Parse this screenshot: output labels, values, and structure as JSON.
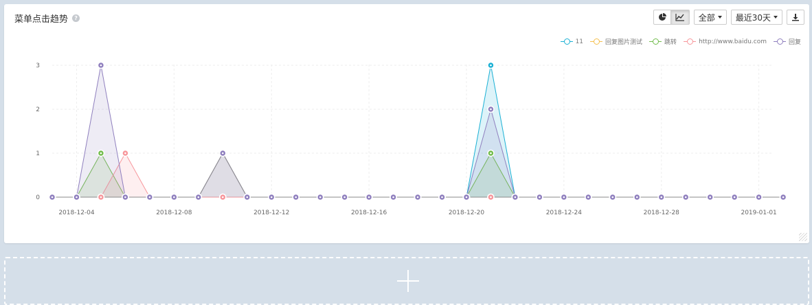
{
  "card": {
    "title": "菜单点击趋势",
    "help_icon": "question-circle-icon"
  },
  "toolbar": {
    "pie_icon": "pie-chart-icon",
    "line_icon": "line-chart-icon",
    "filter_label": "全部",
    "range_label": "最近30天",
    "download_icon": "download-icon"
  },
  "add_panel": {
    "icon": "plus-icon"
  },
  "chart_data": {
    "type": "area",
    "x": [
      "2018-12-03",
      "2018-12-04",
      "2018-12-05",
      "2018-12-06",
      "2018-12-07",
      "2018-12-08",
      "2018-12-09",
      "2018-12-10",
      "2018-12-11",
      "2018-12-12",
      "2018-12-13",
      "2018-12-14",
      "2018-12-15",
      "2018-12-16",
      "2018-12-17",
      "2018-12-18",
      "2018-12-19",
      "2018-12-20",
      "2018-12-21",
      "2018-12-22",
      "2018-12-23",
      "2018-12-24",
      "2018-12-25",
      "2018-12-26",
      "2018-12-27",
      "2018-12-28",
      "2018-12-29",
      "2018-12-30",
      "2018-12-31",
      "2019-01-01",
      "2019-01-02"
    ],
    "x_ticks": [
      "2018-12-04",
      "2018-12-08",
      "2018-12-12",
      "2018-12-16",
      "2018-12-20",
      "2018-12-24",
      "2018-12-28",
      "2019-01-01"
    ],
    "y_ticks": [
      0,
      1,
      2,
      3
    ],
    "ylim": [
      0,
      3
    ],
    "grid": true,
    "legend_position": "top-right",
    "series": [
      {
        "name": "11",
        "color": "#1ab0d4",
        "values": [
          0,
          0,
          0,
          0,
          0,
          0,
          0,
          0,
          0,
          0,
          0,
          0,
          0,
          0,
          0,
          0,
          0,
          0,
          3,
          0,
          0,
          0,
          0,
          0,
          0,
          0,
          0,
          0,
          0,
          0,
          0
        ]
      },
      {
        "name": "回复图片测试",
        "color": "#f5c04e",
        "values": [
          0,
          0,
          0,
          0,
          0,
          0,
          0,
          0,
          0,
          0,
          0,
          0,
          0,
          0,
          0,
          0,
          0,
          0,
          0,
          0,
          0,
          0,
          0,
          0,
          0,
          0,
          0,
          0,
          0,
          0,
          0
        ]
      },
      {
        "name": "跳转",
        "color": "#72bd4c",
        "values": [
          0,
          0,
          1,
          0,
          0,
          0,
          0,
          0,
          0,
          0,
          0,
          0,
          0,
          0,
          0,
          0,
          0,
          0,
          1,
          0,
          0,
          0,
          0,
          0,
          0,
          0,
          0,
          0,
          0,
          0,
          0
        ]
      },
      {
        "name": "http://www.baidu.com",
        "color": "#f7969b",
        "values": [
          0,
          0,
          0,
          1,
          0,
          0,
          0,
          0,
          0,
          0,
          0,
          0,
          0,
          0,
          0,
          0,
          0,
          0,
          0,
          0,
          0,
          0,
          0,
          0,
          0,
          0,
          0,
          0,
          0,
          0,
          0
        ]
      },
      {
        "name": "回复",
        "color": "#8f7fbe",
        "values": [
          0,
          0,
          3,
          0,
          0,
          0,
          0,
          1,
          0,
          0,
          0,
          0,
          0,
          0,
          0,
          0,
          0,
          0,
          2,
          0,
          0,
          0,
          0,
          0,
          0,
          0,
          0,
          0,
          0,
          0,
          0
        ]
      }
    ],
    "extra_series": {
      "color": "#8a8a8a",
      "values": [
        0,
        0,
        0,
        0,
        0,
        0,
        0,
        1,
        0,
        0,
        0,
        0,
        0,
        0,
        0,
        0,
        0,
        0,
        0,
        0,
        0,
        0,
        0,
        0,
        0,
        0,
        0,
        0,
        0,
        0,
        0
      ]
    }
  }
}
